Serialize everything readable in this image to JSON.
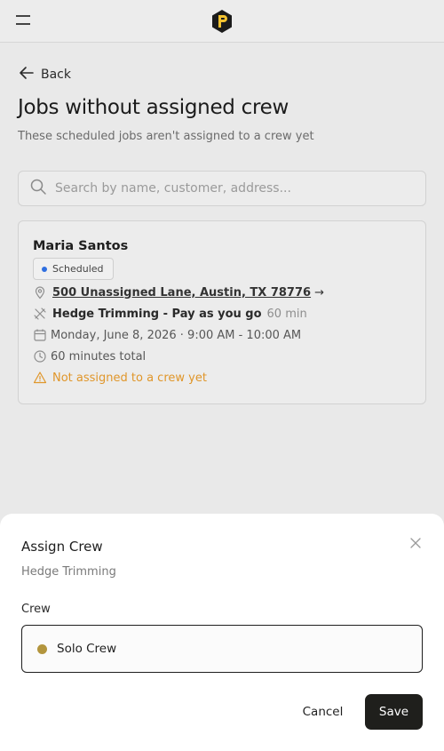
{
  "header": {
    "menu_icon": "hamburger-menu-icon",
    "logo_icon": "brand-logo-icon"
  },
  "nav": {
    "back_label": "Back",
    "back_icon": "arrow-left-icon"
  },
  "page": {
    "title": "Jobs without assigned crew",
    "subtitle": "These scheduled jobs aren't assigned to a crew yet"
  },
  "search": {
    "placeholder": "Search by name, customer, address...",
    "value": "",
    "icon": "search-icon"
  },
  "job": {
    "customer": "Maria Santos",
    "status": "Scheduled",
    "status_color": "#2f6fe0",
    "address": "500 Unassigned Lane, Austin, TX 78776",
    "address_arrow": "→",
    "service": "Hedge Trimming - Pay as you go",
    "service_duration": "60 min",
    "date_time": "Monday, June 8, 2026 · 9:00 AM - 10:00 AM",
    "total_duration": "60 minutes total",
    "warning": "Not assigned to a crew yet",
    "warning_color": "#e0962a"
  },
  "sheet": {
    "title": "Assign Crew",
    "subtitle": "Hedge Trimming",
    "close_icon": "close-icon",
    "crew_label": "Crew",
    "crew_selected": "Solo Crew",
    "crew_color": "#b3953d",
    "cancel_label": "Cancel",
    "save_label": "Save"
  }
}
